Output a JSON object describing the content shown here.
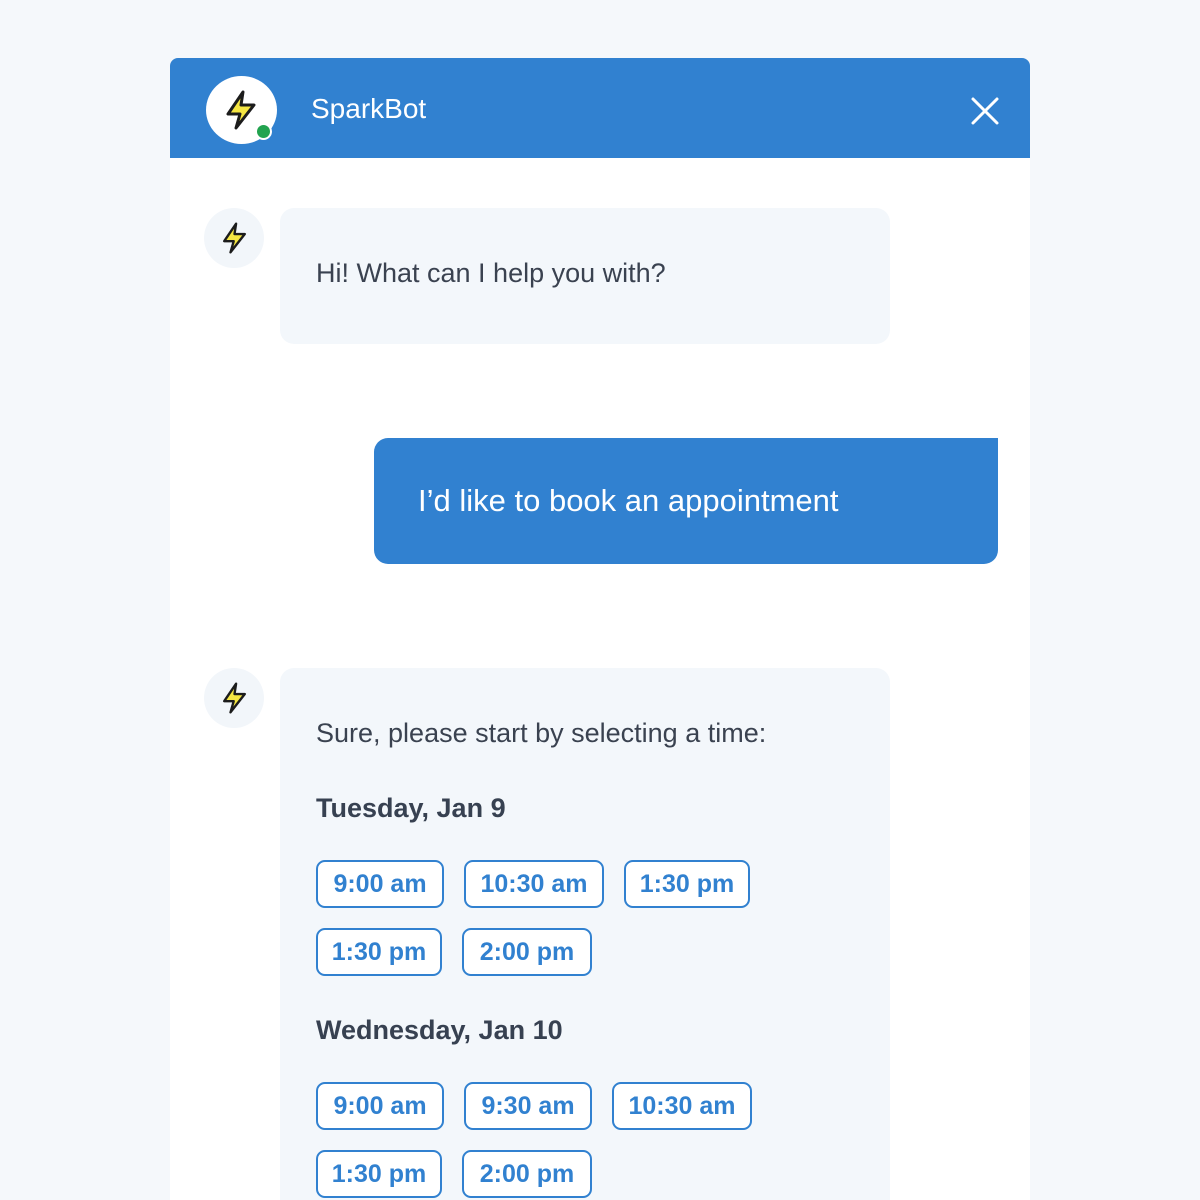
{
  "header": {
    "bot_name": "SparkBot",
    "status": "online",
    "avatar_icon": "lightning-bolt-icon",
    "close_icon": "close-icon"
  },
  "messages": [
    {
      "sender": "bot",
      "text": "Hi! What can I help you with?"
    },
    {
      "sender": "user",
      "text": "I’d like to book an appointment"
    },
    {
      "sender": "bot",
      "text": "Sure, please start by selecting a time:",
      "days": [
        {
          "label": "Tuesday, Jan 9",
          "slots": [
            "9:00 am",
            "10:30 am",
            "1:30 pm",
            "1:30 pm",
            "2:00 pm"
          ]
        },
        {
          "label": "Wednesday, Jan 10",
          "slots": [
            "9:00 am",
            "9:30 am",
            "10:30 am",
            "1:30 pm",
            "2:00 pm"
          ]
        }
      ]
    }
  ],
  "colors": {
    "brand_blue": "#3181d0",
    "online_green": "#22a34f",
    "bolt_yellow": "#f5e642",
    "bot_bubble": "#f3f7fb",
    "page_background": "#f5f8fb"
  }
}
